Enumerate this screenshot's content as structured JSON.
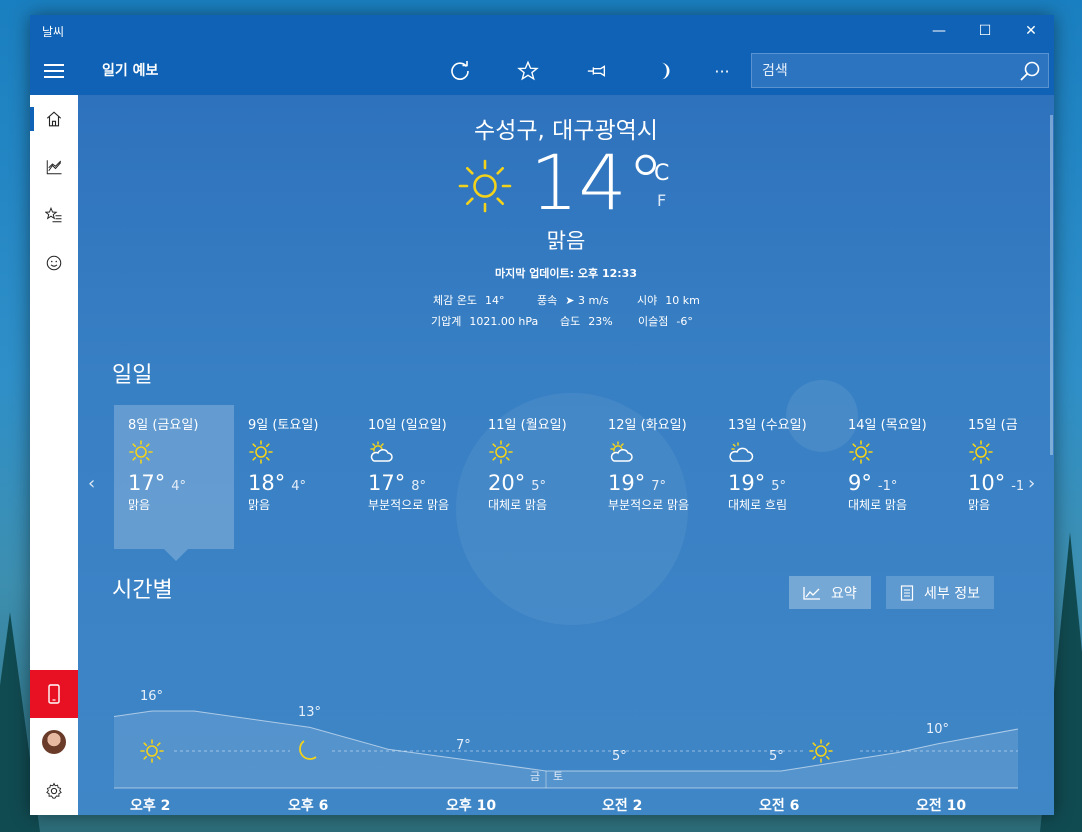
{
  "window": {
    "title": "날씨",
    "controls": {
      "min": "—",
      "max": "☐",
      "close": "✕"
    }
  },
  "appbar": {
    "title": "일기 예보",
    "tools": [
      "refresh-icon",
      "favorite-icon",
      "pin-icon",
      "dark-mode-icon",
      "more-icon"
    ],
    "more_label": "···",
    "search_placeholder": "검색"
  },
  "sidebar": {
    "items": [
      "home-icon",
      "chart-icon",
      "favorites-list-icon",
      "smiley-icon"
    ],
    "bottom": [
      "phone-icon",
      "avatar",
      "settings-icon"
    ]
  },
  "current": {
    "location": "수성구, 대구광역시",
    "temp": "14°",
    "unit_c": "C",
    "unit_f": "F",
    "condition": "맑음",
    "updated": "마지막 업데이트: 오후 12:33",
    "stats": [
      {
        "label": "체감 온도",
        "value": "14°"
      },
      {
        "label": "풍속",
        "value": "➤ 3 m/s"
      },
      {
        "label": "시야",
        "value": "10 km"
      },
      {
        "label": "기압계",
        "value": "1021.00 hPa"
      },
      {
        "label": "습도",
        "value": "23%"
      },
      {
        "label": "이슬점",
        "value": "-6°"
      }
    ]
  },
  "daily": {
    "title": "일일",
    "days": [
      {
        "date": "8일 (금요일)",
        "icon": "sun",
        "high": "17°",
        "low": "4°",
        "cond": "맑음",
        "selected": true
      },
      {
        "date": "9일 (토요일)",
        "icon": "sun",
        "high": "18°",
        "low": "4°",
        "cond": "맑음"
      },
      {
        "date": "10일 (일요일)",
        "icon": "partly-cloudy",
        "high": "17°",
        "low": "8°",
        "cond": "부분적으로 맑음"
      },
      {
        "date": "11일 (월요일)",
        "icon": "sun",
        "high": "20°",
        "low": "5°",
        "cond": "대체로 맑음"
      },
      {
        "date": "12일 (화요일)",
        "icon": "partly-cloudy",
        "high": "19°",
        "low": "7°",
        "cond": "부분적으로 맑음"
      },
      {
        "date": "13일 (수요일)",
        "icon": "cloudy",
        "high": "19°",
        "low": "5°",
        "cond": "대체로 흐림"
      },
      {
        "date": "14일 (목요일)",
        "icon": "sun",
        "high": "9°",
        "low": "-1°",
        "cond": "대체로 맑음"
      },
      {
        "date": "15일 (금",
        "icon": "sun",
        "high": "10°",
        "low": "-1",
        "cond": "맑음"
      }
    ]
  },
  "hourly": {
    "title": "시간별",
    "summary_label": "요약",
    "detail_label": "세부 정보",
    "temps": [
      {
        "label": "16°",
        "value": 16
      },
      {
        "label": "13°",
        "value": 13
      },
      {
        "label": "7°",
        "value": 7
      },
      {
        "label": "5°",
        "value": 5
      },
      {
        "label": "5°",
        "value": 5
      },
      {
        "label": "10°",
        "value": 10
      }
    ],
    "times": [
      "오후 2",
      "오후 6",
      "오후 10",
      "오전 2",
      "오전 6",
      "오전 10"
    ],
    "day_left": "금",
    "day_right": "토"
  },
  "colors": {
    "accent": "#0f62b5",
    "sun": "#f2d21b",
    "phone_button": "#e81123"
  }
}
